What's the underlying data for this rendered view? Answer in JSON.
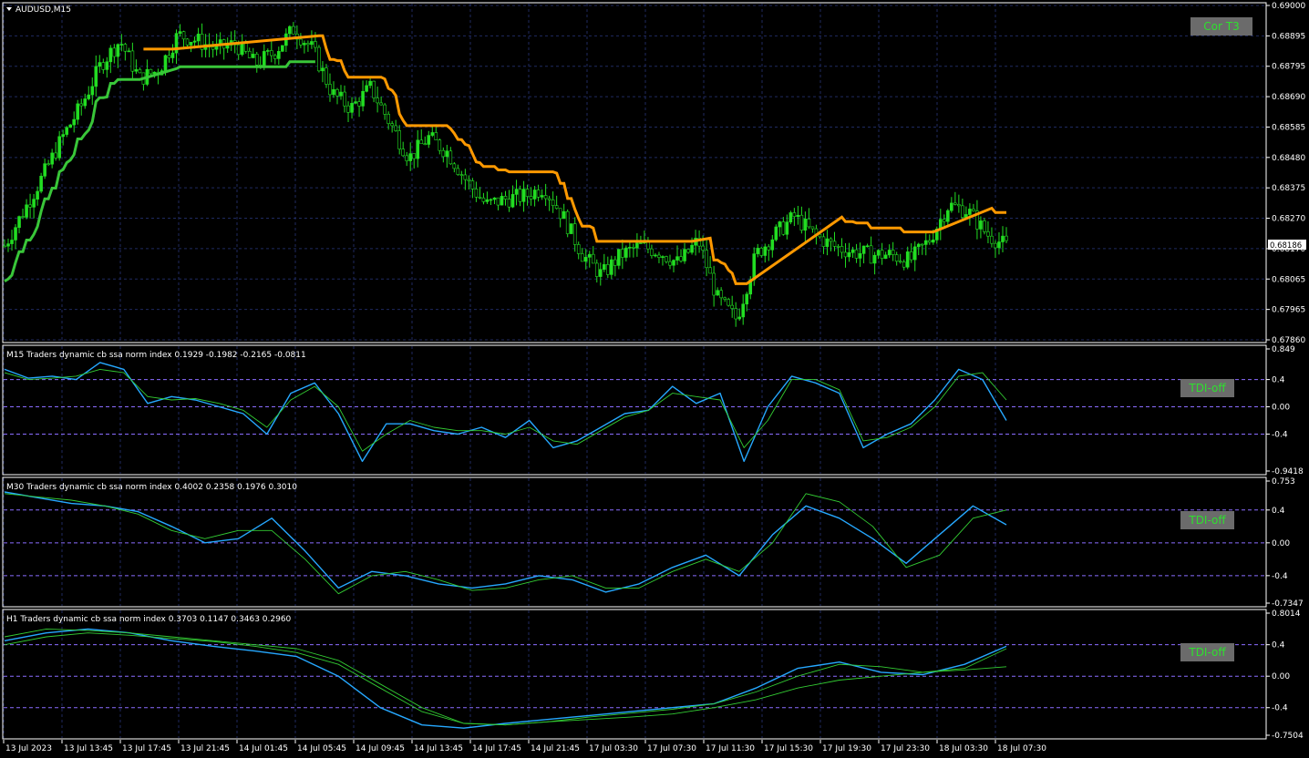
{
  "symbol_title": "AUDUSD,M15",
  "colors": {
    "background": "#000000",
    "grid": "#1f2a60",
    "axis": "#ffffff",
    "bull": "#22dd22",
    "bear": "#22dd22",
    "line_up": "#39c639",
    "line_down": "#ff9900",
    "osc_fast": "#26a8ff",
    "osc_slow": "#33cc33",
    "osc_level": "#8a6cff"
  },
  "buttons": {
    "cor": "Cor T3",
    "tdi1": "TDI-off",
    "tdi2": "TDI-off",
    "tdi3": "TDI-off"
  },
  "chart_data": [
    {
      "type": "candlestick",
      "title": "AUDUSD,M15",
      "y_ticks": [
        "0.69000",
        "0.68895",
        "0.68795",
        "0.68690",
        "0.68585",
        "0.68480",
        "0.68375",
        "0.68270",
        "0.68170",
        "0.68065",
        "0.67965",
        "0.67860"
      ],
      "ylim": [
        0.6786,
        0.69
      ],
      "current_price": "0.68186",
      "x_ticks": [
        "13 Jul 2023",
        "13 Jul 13:45",
        "13 Jul 17:45",
        "13 Jul 21:45",
        "14 Jul 01:45",
        "14 Jul 05:45",
        "14 Jul 09:45",
        "14 Jul 13:45",
        "14 Jul 17:45",
        "14 Jul 21:45",
        "17 Jul 03:30",
        "17 Jul 07:30",
        "17 Jul 11:30",
        "17 Jul 15:30",
        "17 Jul 19:30",
        "17 Jul 23:30",
        "18 Jul 03:30",
        "18 Jul 07:30"
      ],
      "close_path": [
        0.6818,
        0.683,
        0.6842,
        0.6855,
        0.6866,
        0.688,
        0.6888,
        0.6875,
        0.6878,
        0.689,
        0.6888,
        0.6885,
        0.6887,
        0.688,
        0.6884,
        0.6892,
        0.6885,
        0.687,
        0.6865,
        0.6872,
        0.686,
        0.6848,
        0.6855,
        0.685,
        0.684,
        0.6832,
        0.6834,
        0.6835,
        0.6838,
        0.6828,
        0.6815,
        0.6808,
        0.6815,
        0.6818,
        0.6816,
        0.6812,
        0.682,
        0.68,
        0.6793,
        0.6815,
        0.6822,
        0.6828,
        0.6822,
        0.6818,
        0.6816,
        0.6815,
        0.6815,
        0.6813,
        0.682,
        0.6832,
        0.683,
        0.6822,
        0.6818
      ]
    },
    {
      "type": "line",
      "title": "M15  Traders dynamic cb ssa norm index 0.1929 -0.1982 -0.2165 -0.0811",
      "y_ticks": [
        "0.849",
        "0.4",
        "0.00",
        "-0.4",
        "-0.9418"
      ],
      "ylim": [
        -0.9418,
        0.849
      ],
      "series": [
        {
          "values": [
            0.55,
            0.42,
            0.45,
            0.4,
            0.65,
            0.55,
            0.05,
            0.15,
            0.1,
            0.0,
            -0.1,
            -0.4,
            0.2,
            0.35,
            -0.1,
            -0.8,
            -0.25,
            -0.25,
            -0.35,
            -0.4,
            -0.3,
            -0.45,
            -0.2,
            -0.6,
            -0.5,
            -0.3,
            -0.1,
            -0.05,
            0.3,
            0.05,
            0.2,
            -0.8,
            0.0,
            0.45,
            0.35,
            0.2,
            -0.6,
            -0.4,
            -0.25,
            0.1,
            0.55,
            0.4,
            -0.2
          ]
        },
        {
          "values": [
            0.5,
            0.4,
            0.42,
            0.45,
            0.55,
            0.5,
            0.15,
            0.1,
            0.12,
            0.05,
            -0.05,
            -0.3,
            0.1,
            0.3,
            0.0,
            -0.65,
            -0.4,
            -0.2,
            -0.3,
            -0.35,
            -0.35,
            -0.4,
            -0.3,
            -0.5,
            -0.55,
            -0.35,
            -0.15,
            -0.05,
            0.2,
            0.15,
            0.1,
            -0.6,
            -0.2,
            0.4,
            0.4,
            0.25,
            -0.5,
            -0.45,
            -0.3,
            0.0,
            0.45,
            0.5,
            0.1
          ]
        }
      ]
    },
    {
      "type": "line",
      "title": "M30  Traders dynamic cb ssa norm index 0.4002 0.2358 0.1976 0.3010",
      "y_ticks": [
        "0.753",
        "0.4",
        "0.00",
        "-0.4",
        "-0.7347"
      ],
      "ylim": [
        -0.7347,
        0.753
      ],
      "series": [
        {
          "values": [
            0.62,
            0.55,
            0.48,
            0.45,
            0.38,
            0.2,
            0.0,
            0.05,
            0.3,
            -0.1,
            -0.55,
            -0.35,
            -0.4,
            -0.5,
            -0.55,
            -0.5,
            -0.4,
            -0.45,
            -0.6,
            -0.5,
            -0.3,
            -0.15,
            -0.4,
            0.1,
            0.45,
            0.3,
            0.05,
            -0.25,
            0.1,
            0.45,
            0.22
          ]
        },
        {
          "values": [
            0.6,
            0.56,
            0.52,
            0.45,
            0.35,
            0.15,
            0.05,
            0.15,
            0.15,
            -0.2,
            -0.62,
            -0.4,
            -0.35,
            -0.45,
            -0.58,
            -0.55,
            -0.45,
            -0.4,
            -0.55,
            -0.55,
            -0.35,
            -0.2,
            -0.35,
            0.0,
            0.6,
            0.5,
            0.2,
            -0.3,
            -0.15,
            0.3,
            0.4
          ]
        }
      ]
    },
    {
      "type": "line",
      "title": "H1  Traders dynamic cb ssa norm index 0.3703 0.1147 0.3463 0.2960",
      "y_ticks": [
        "0.8014",
        "0.4",
        "0.00",
        "-0.4",
        "-0.7504"
      ],
      "ylim": [
        -0.7504,
        0.8014
      ],
      "series": [
        {
          "values": [
            0.45,
            0.55,
            0.6,
            0.55,
            0.45,
            0.38,
            0.32,
            0.25,
            0.0,
            -0.4,
            -0.62,
            -0.66,
            -0.6,
            -0.55,
            -0.5,
            -0.45,
            -0.4,
            -0.35,
            -0.15,
            0.1,
            0.18,
            0.05,
            0.02,
            0.15,
            0.38
          ]
        },
        {
          "values": [
            0.5,
            0.6,
            0.58,
            0.55,
            0.5,
            0.45,
            0.4,
            0.35,
            0.2,
            -0.1,
            -0.4,
            -0.6,
            -0.62,
            -0.58,
            -0.52,
            -0.47,
            -0.42,
            -0.35,
            -0.2,
            0.0,
            0.15,
            0.12,
            0.05,
            0.1,
            0.35
          ]
        },
        {
          "values": [
            0.4,
            0.5,
            0.55,
            0.52,
            0.48,
            0.44,
            0.38,
            0.3,
            0.15,
            -0.15,
            -0.45,
            -0.6,
            -0.62,
            -0.58,
            -0.55,
            -0.52,
            -0.48,
            -0.4,
            -0.3,
            -0.15,
            -0.05,
            0.0,
            0.05,
            0.08,
            0.12
          ]
        }
      ]
    }
  ]
}
